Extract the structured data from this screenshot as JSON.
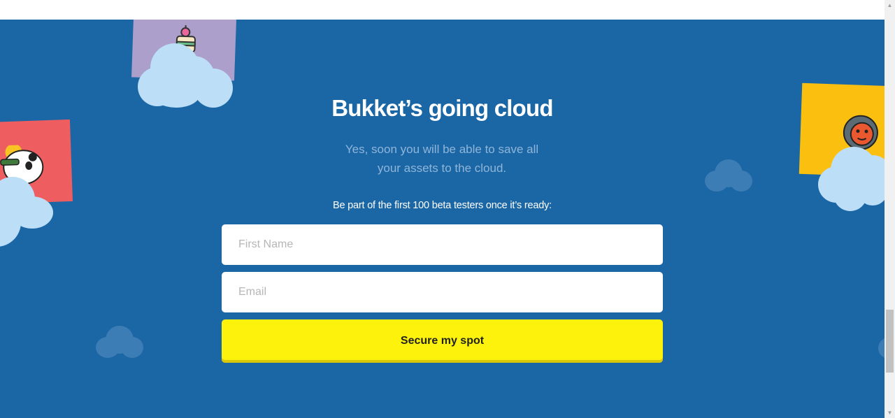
{
  "page": {
    "title": "Bukket’s going cloud",
    "subtitle": "Yes, soon you will be able to save all your assets to the cloud.",
    "cta_text": "Be part of the first 100 beta testers once it’s ready:"
  },
  "form": {
    "first_name_placeholder": "First Name",
    "email_placeholder": "Email",
    "submit_label": "Secure my spot"
  },
  "colors": {
    "background": "#1b67a6",
    "button": "#fdf20b",
    "card_purple": "#ad9fcc",
    "card_red": "#ee5d5f",
    "card_yellow": "#fbbf0f",
    "cloud": "#bcdef7"
  },
  "icons": {
    "cake_sticker": "cake-illustration",
    "panda_sticker": "panda-illustration",
    "fox_sticker": "fox-illustration"
  }
}
